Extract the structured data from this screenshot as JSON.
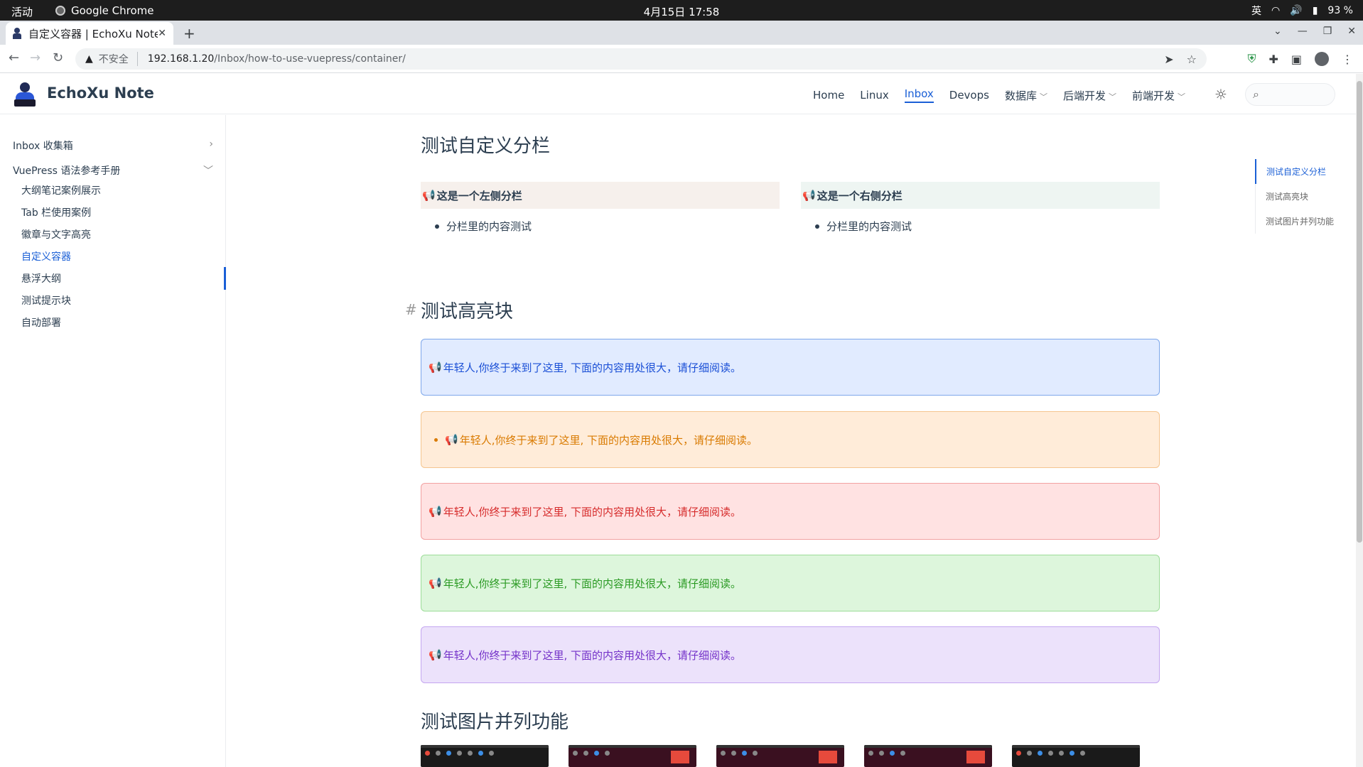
{
  "system": {
    "activities": "活动",
    "app": "Google Chrome",
    "clock": "4月15日 17:58",
    "ime": "英",
    "battery": "93 %"
  },
  "browser": {
    "tab_title": "自定义容器 | EchoXu Note",
    "insecure_label": "不安全",
    "url_host": "192.168.1.20",
    "url_path": "/Inbox/how-to-use-vuepress/container/"
  },
  "site": {
    "title": "EchoXu Note",
    "nav": [
      "Home",
      "Linux",
      "Inbox",
      "Devops",
      "数据库",
      "后端开发",
      "前端开发"
    ],
    "active_nav": "Inbox"
  },
  "sidebar": {
    "groups": [
      {
        "label": "Inbox 收集箱",
        "expanded": false
      },
      {
        "label": "VuePress 语法参考手册",
        "expanded": true
      }
    ],
    "items": [
      "大纲笔记案例展示",
      "Tab 栏使用案例",
      "徽章与文字高亮",
      "自定义容器",
      "悬浮大纲",
      "测试提示块",
      "自动部署"
    ],
    "active_item": "自定义容器"
  },
  "main": {
    "section1": {
      "title": "测试自定义分栏",
      "left_head": "这是一个左侧分栏",
      "right_head": "这是一个右侧分栏",
      "left_body": "分栏里的内容测试",
      "right_body": "分栏里的内容测试"
    },
    "section2": {
      "anchor": "#",
      "title": "测试高亮块",
      "text": "年轻人,你终于来到了这里, 下面的内容用处很大，请仔细阅读。"
    },
    "section3": {
      "title": "测试图片并列功能"
    }
  },
  "toc": [
    "测试自定义分栏",
    "测试高亮块",
    "测试图片并列功能"
  ],
  "colors": {
    "accent": "#1a5fd6",
    "blue": "#1a4fd6",
    "orange": "#d97a00",
    "red": "#d62b2b",
    "green": "#2a9a23",
    "purple": "#7432c9"
  }
}
